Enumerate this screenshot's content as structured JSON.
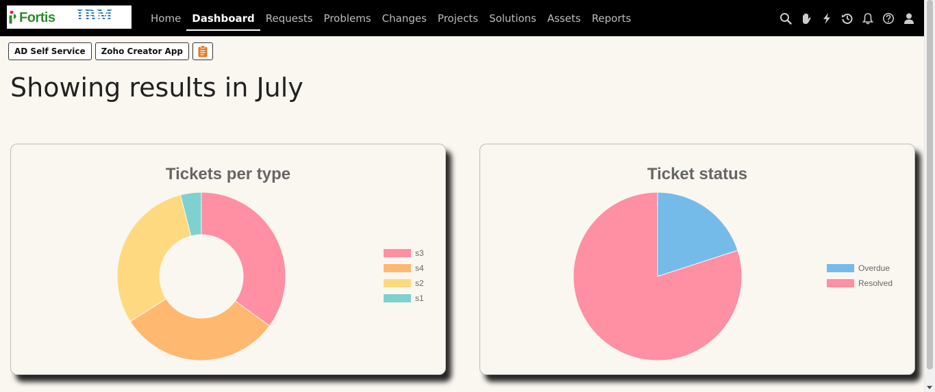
{
  "brand": {
    "logo_text_1": "Fortis",
    "logo_text_2": "IBM"
  },
  "nav": {
    "items": [
      {
        "label": "Home",
        "active": false
      },
      {
        "label": "Dashboard",
        "active": true
      },
      {
        "label": "Requests",
        "active": false
      },
      {
        "label": "Problems",
        "active": false
      },
      {
        "label": "Changes",
        "active": false
      },
      {
        "label": "Projects",
        "active": false
      },
      {
        "label": "Solutions",
        "active": false
      },
      {
        "label": "Assets",
        "active": false
      },
      {
        "label": "Reports",
        "active": false
      }
    ],
    "right_icons": [
      "search-icon",
      "hand-icon",
      "lightning-icon",
      "history-icon",
      "bell-icon",
      "help-icon",
      "user-icon"
    ]
  },
  "toolbar": {
    "ad_self_service_label": "AD Self Service",
    "zoho_creator_label": "Zoho Creator App",
    "clipboard_icon": "clipboard-icon"
  },
  "page": {
    "title": "Showing results in July"
  },
  "colors": {
    "nav_bg": "#000000",
    "page_bg": "#faf7f0",
    "pink": "#ff8fa3",
    "orange": "#ffb870",
    "yellow": "#ffd980",
    "teal": "#7fd1cf",
    "blue": "#75bbea"
  },
  "chart_data": [
    {
      "type": "pie",
      "variant": "doughnut",
      "title": "Tickets per type",
      "categories": [
        "s3",
        "s4",
        "s2",
        "s1"
      ],
      "values": [
        35,
        31,
        30,
        4
      ],
      "colors": [
        "#ff8fa3",
        "#ffb870",
        "#ffd980",
        "#7fd1cf"
      ],
      "legend": "right"
    },
    {
      "type": "pie",
      "title": "Ticket status",
      "categories": [
        "Overdue",
        "Resolved"
      ],
      "values": [
        20,
        80
      ],
      "colors": [
        "#75bbea",
        "#ff8fa3"
      ],
      "legend": "right"
    }
  ]
}
